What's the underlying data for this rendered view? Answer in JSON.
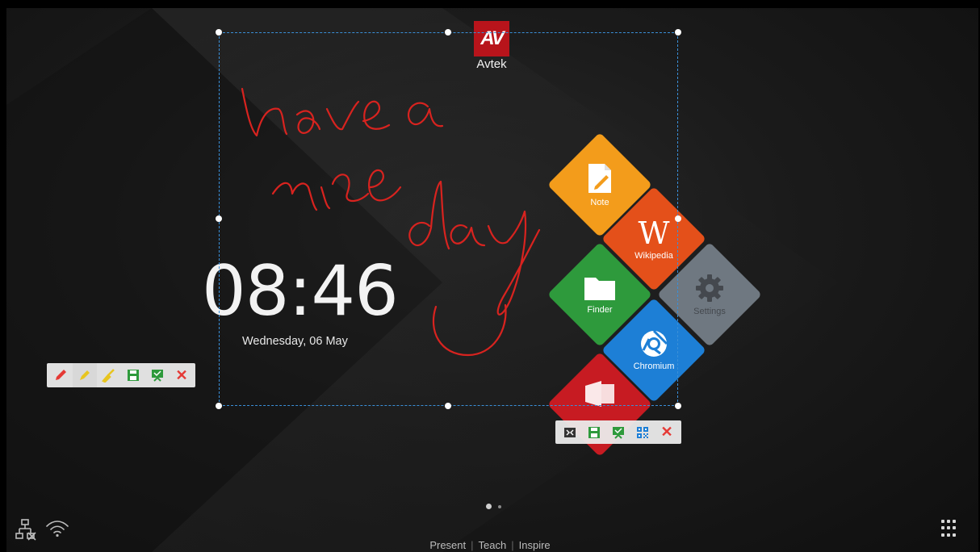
{
  "brand": {
    "logo_letters": "AV",
    "name": "Avtek"
  },
  "clock": {
    "time": "08:46",
    "date": "Wednesday, 06 May"
  },
  "tiles": [
    {
      "label": "Note",
      "color": "#f39c1b"
    },
    {
      "label": "Wikipedia",
      "color": "#e4501a"
    },
    {
      "label": "Finder",
      "color": "#2e9a3c"
    },
    {
      "label": "Settings",
      "color": "#7b858f"
    },
    {
      "label": "Chromium",
      "color": "#1d7fd6"
    },
    {
      "label": "",
      "color": "#c71b22"
    }
  ],
  "pen_toolbar": {
    "tools": [
      "pen-icon",
      "highlighter-icon",
      "eraser-icon",
      "save-icon",
      "whiteboard-icon",
      "close-icon"
    ]
  },
  "selection_toolbar": {
    "tools": [
      "screenshot-icon",
      "save-icon",
      "whiteboard-icon",
      "qr-code-icon",
      "close-icon"
    ]
  },
  "footer": {
    "tagline": [
      "Present",
      "Teach",
      "Inspire"
    ],
    "page_count": 2,
    "active_page": 1
  },
  "colors": {
    "ink": "#d8231f",
    "selection": "#3a8fd8"
  }
}
